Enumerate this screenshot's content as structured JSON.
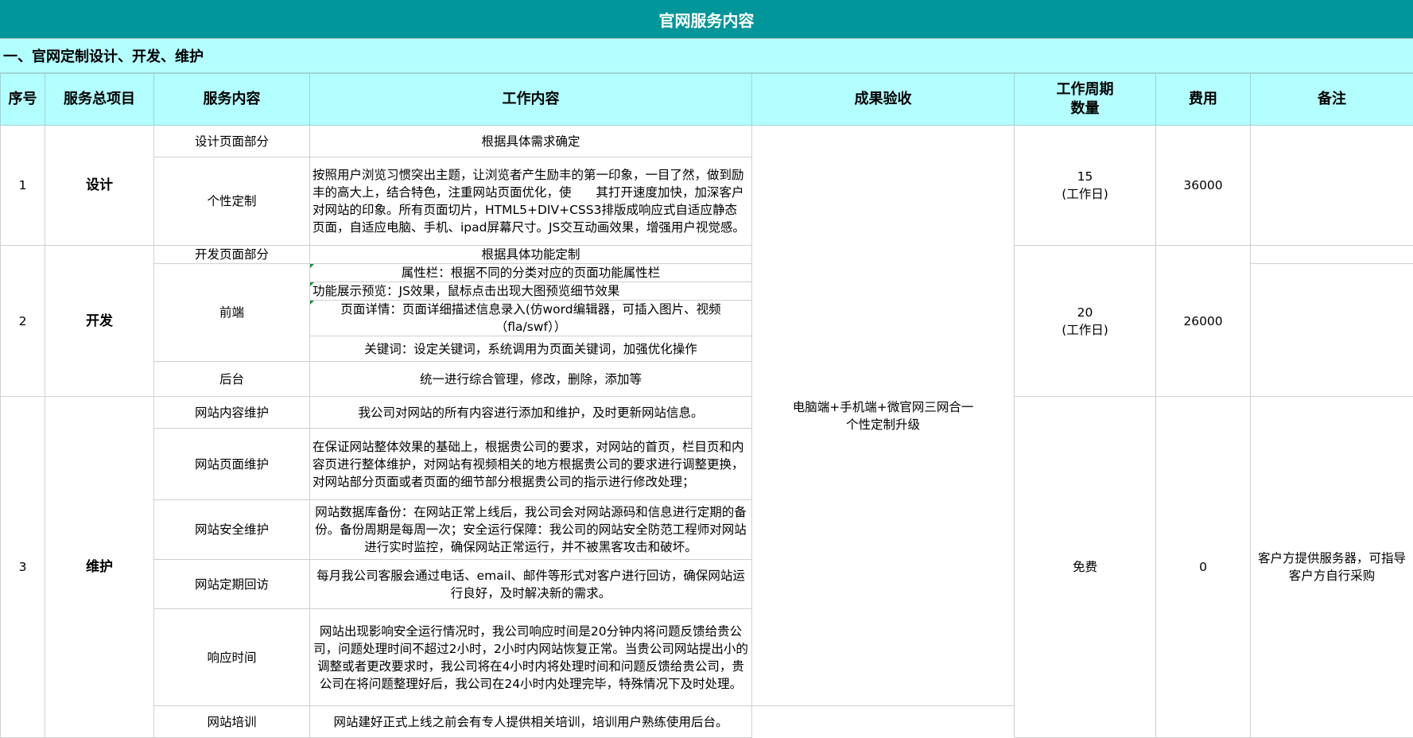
{
  "title": "官网服务内容",
  "section": "一、官网定制设计、开发、维护",
  "headers": [
    "序号",
    "服务总项目",
    "服务内容",
    "工作内容",
    "成果验收",
    "工作周期\n数量",
    "费用",
    "备注"
  ],
  "acceptance": "电脑端+手机端+微官网三网合一\n个性定制升级",
  "groups": [
    {
      "no": "1",
      "project": "设计",
      "cycle": "15\n(工作日)",
      "fee": "36000",
      "items": [
        {
          "service": "设计页面部分",
          "work": "根据具体需求确定"
        },
        {
          "service": "个性定制",
          "work": "按照用户浏览习惯突出主题，让浏览者产生励丰的第一印象，一目了然，做到励丰的高大上，结合特色，注重网站页面优化，使　　其打开速度加快，加深客户对网站的印象。所有页面切片，HTML5+DIV+CSS3排版成响应式自适应静态页面，自适应电脑、手机、ipad屏幕尺寸。JS交互动画效果，增强用户视觉感。"
        }
      ]
    },
    {
      "no": "2",
      "project": "开发",
      "cycle": "20\n(工作日)",
      "fee": "26000",
      "items": [
        {
          "service": "开发页面部分",
          "work": "根据具体功能定制"
        },
        {
          "service": "前端",
          "works": [
            "属性栏：根据不同的分类对应的页面功能属性栏",
            "功能展示预览：JS效果，鼠标点击出现大图预览细节效果",
            "页面详情：页面详细描述信息录入(仿word编辑器，可插入图片、视频（fla/swf））",
            "关键词：设定关键词，系统调用为页面关键词，加强优化操作"
          ]
        },
        {
          "service": "后台",
          "work": "统一进行综合管理，修改，删除，添加等"
        }
      ]
    },
    {
      "no": "3",
      "project": "维护",
      "cycle": "免费",
      "fee": "0",
      "note": "客户方提供服务器，可指导客户方自行采购",
      "items": [
        {
          "service": "网站内容维护",
          "work": "我公司对网站的所有内容进行添加和维护，及时更新网站信息。"
        },
        {
          "service": "网站页面维护",
          "work": "在保证网站整体效果的基础上，根据贵公司的要求，对网站的首页，栏目页和内容页进行整体维护，对网站有视频相关的地方根据贵公司的要求进行调整更换，对网站部分页面或者页面的细节部分根据贵公司的指示进行修改处理；"
        },
        {
          "service": "网站安全维护",
          "work": "网站数据库备份：在网站正常上线后，我公司会对网站源码和信息进行定期的备份。备份周期是每周一次；安全运行保障：我公司的网站安全防范工程师对网站进行实时监控，确保网站正常运行，并不被黑客攻击和破坏。"
        },
        {
          "service": "网站定期回访",
          "work": "每月我公司客服会通过电话、email、邮件等形式对客户进行回访，确保网站运行良好，及时解决新的需求。"
        },
        {
          "service": "响应时间",
          "work": "网站出现影响安全运行情况时，我公司响应时间是20分钟内将问题反馈给贵公司，问题处理时间不超过2小时，2小时内网站恢复正常。当贵公司网站提出小的调整或者更改要求时，我公司将在4小时内将处理时间和问题反馈给贵公司，贵公司在将问题整理好后，我公司在24小时内处理完毕，特殊情况下及时处理。"
        },
        {
          "service": "网站培训",
          "work": "网站建好正式上线之前会有专人提供相关培训，培训用户熟练使用后台。"
        }
      ]
    }
  ]
}
